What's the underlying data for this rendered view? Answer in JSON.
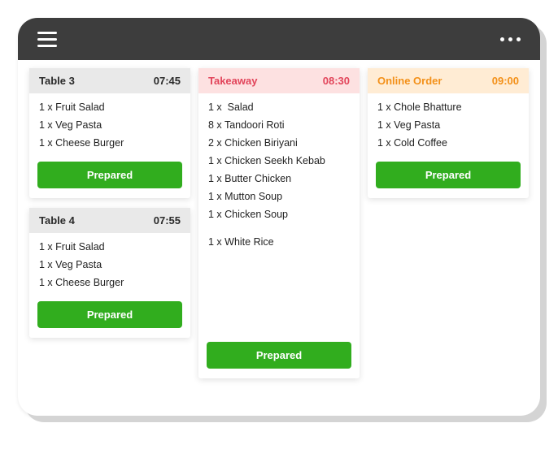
{
  "cards": [
    {
      "id": "table3",
      "title": "Table 3",
      "time": "07:45",
      "type": "dine",
      "items": [
        {
          "qty": "1",
          "name": "Fruit Salad"
        },
        {
          "qty": "1",
          "name": "Veg Pasta"
        },
        {
          "qty": "1",
          "name": "Cheese Burger"
        }
      ],
      "button": "Prepared"
    },
    {
      "id": "table4",
      "title": "Table 4",
      "time": "07:55",
      "type": "dine",
      "items": [
        {
          "qty": "1",
          "name": "Fruit Salad"
        },
        {
          "qty": "1",
          "name": "Veg Pasta"
        },
        {
          "qty": "1",
          "name": "Cheese Burger"
        }
      ],
      "button": "Prepared"
    },
    {
      "id": "takeaway",
      "title": "Takeaway",
      "time": "08:30",
      "type": "takeaway",
      "items": [
        {
          "qty": "1",
          "name": "Salad"
        },
        {
          "qty": "8",
          "name": "Tandoori Roti"
        },
        {
          "qty": "2",
          "name": "Chicken Biriyani"
        },
        {
          "qty": "1",
          "name": "Chicken Seekh Kebab"
        },
        {
          "qty": "1",
          "name": "Butter Chicken"
        },
        {
          "qty": "1",
          "name": "Mutton Soup"
        },
        {
          "qty": "1",
          "name": "Chicken Soup"
        },
        {
          "qty": "1",
          "name": "White Rice"
        }
      ],
      "button": "Prepared"
    },
    {
      "id": "online",
      "title": "Online Order",
      "time": "09:00",
      "type": "online",
      "items": [
        {
          "qty": "1",
          "name": "Chole Bhatture"
        },
        {
          "qty": "1",
          "name": "Veg Pasta"
        },
        {
          "qty": "1",
          "name": "Cold Coffee"
        }
      ],
      "button": "Prepared"
    }
  ]
}
